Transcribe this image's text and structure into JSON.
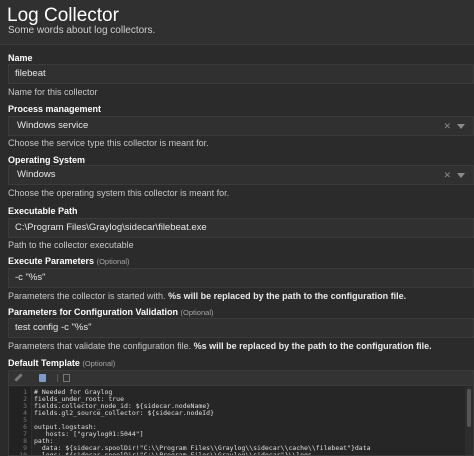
{
  "header": {
    "title": "Log Collector",
    "subtitle": "Some words about log collectors."
  },
  "name": {
    "label": "Name",
    "value": "filebeat",
    "help": "Name for this collector"
  },
  "process_management": {
    "label": "Process management",
    "value": "Windows service",
    "help": "Choose the service type this collector is meant for."
  },
  "operating_system": {
    "label": "Operating System",
    "value": "Windows",
    "help": "Choose the operating system this collector is meant for."
  },
  "executable_path": {
    "label": "Executable Path",
    "value": "C:\\Program Files\\Graylog\\sidecar\\filebeat.exe",
    "help": "Path to the collector executable"
  },
  "execute_parameters": {
    "label": "Execute Parameters",
    "optional": "(Optional)",
    "value": "-c \"%s\"",
    "help_prefix": "Parameters the collector is started with. ",
    "help_bold": "%s will be replaced by the path to the configuration file."
  },
  "validation_parameters": {
    "label": "Parameters for Configuration Validation",
    "optional": "(Optional)",
    "value": "test config -c \"%s\"",
    "help_prefix": "Parameters that validate the configuration file. ",
    "help_bold": "%s will be replaced by the path to the configuration file."
  },
  "default_template": {
    "label": "Default Template",
    "optional": "(Optional)",
    "lines": [
      {
        "n": "1",
        "text": "# Needed for Graylog"
      },
      {
        "n": "2",
        "text": "fields_under_root: true"
      },
      {
        "n": "3",
        "text": "fields.collector_node_id: ${sidecar.nodeName}"
      },
      {
        "n": "4",
        "text": "fields.gl2_source_collector: ${sidecar.nodeId}"
      },
      {
        "n": "5",
        "text": ""
      },
      {
        "n": "6",
        "text": "output.logstash:"
      },
      {
        "n": "7",
        "text": "   hosts: [\"graylog01:5044\"]"
      },
      {
        "n": "8",
        "text": "path:"
      },
      {
        "n": "9",
        "text": "  data: ${sidecar.spoolDir!\"C:\\\\Program Files\\\\Graylog\\\\sidecar\\\\cache\\\\filebeat\"}data"
      },
      {
        "n": "10",
        "text": "  logs: ${sidecar.spoolDir!\"C:\\\\Program Files\\\\Graylog\\\\sidecar\"}\\\\logs"
      }
    ]
  },
  "icons": {
    "clear": "close-icon",
    "dropdown": "chevron-down-icon",
    "toolbar": [
      "pencil-icon",
      "save-icon",
      "document-icon"
    ]
  },
  "colors": {
    "background": "#2b2b2b",
    "field": "#303030",
    "text": "#e3e3e3"
  }
}
